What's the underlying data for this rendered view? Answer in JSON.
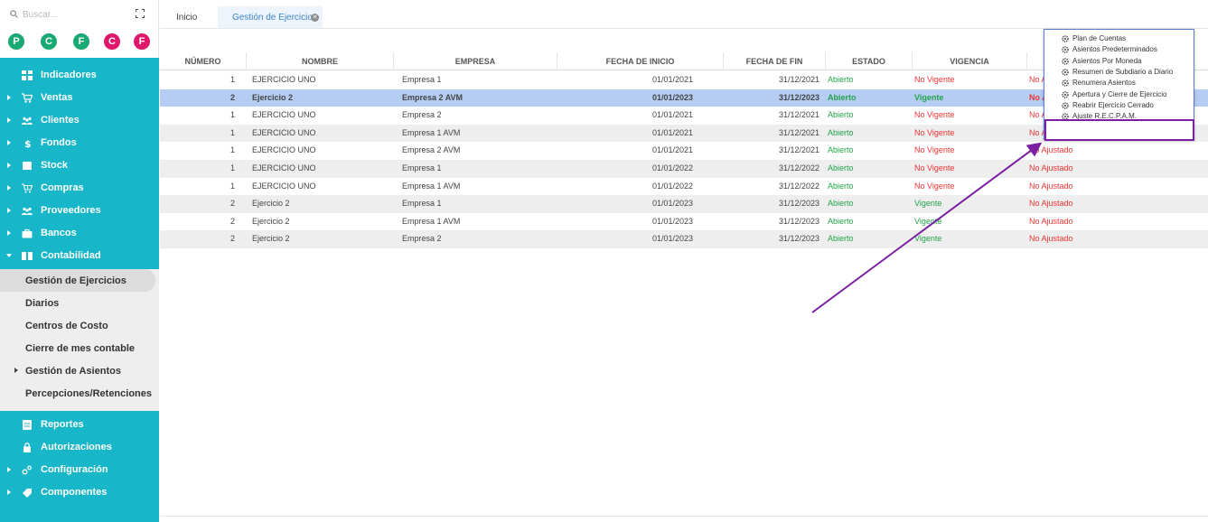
{
  "search": {
    "placeholder": "Buscar..."
  },
  "avatars": [
    {
      "letter": "P",
      "color": "#19a974"
    },
    {
      "letter": "C",
      "color": "#19a974"
    },
    {
      "letter": "F",
      "color": "#19a974"
    },
    {
      "letter": "C",
      "color": "#e0186c"
    },
    {
      "letter": "F",
      "color": "#e0186c"
    }
  ],
  "sidebar": {
    "items": [
      {
        "label": "Indicadores"
      },
      {
        "label": "Ventas"
      },
      {
        "label": "Clientes"
      },
      {
        "label": "Fondos"
      },
      {
        "label": "Stock"
      },
      {
        "label": "Compras"
      },
      {
        "label": "Proveedores"
      },
      {
        "label": "Bancos"
      },
      {
        "label": "Contabilidad"
      }
    ],
    "submenu": [
      {
        "label": "Gestión de Ejercicios"
      },
      {
        "label": "Diarios"
      },
      {
        "label": "Centros de Costo"
      },
      {
        "label": "Cierre de mes contable"
      },
      {
        "label": "Gestión de Asientos"
      },
      {
        "label": "Percepciones/Retenciones"
      }
    ],
    "bottom_items": [
      {
        "label": "Reportes"
      },
      {
        "label": "Autorizaciones"
      },
      {
        "label": "Configuración"
      },
      {
        "label": "Componentes"
      }
    ]
  },
  "tabs": {
    "home": "Inicio",
    "active": "Gestión de Ejercicios"
  },
  "table": {
    "columns": [
      "NÚMERO",
      "NOMBRE",
      "EMPRESA",
      "FECHA DE INICIO",
      "FECHA DE FIN",
      "ESTADO",
      "VIGENCIA"
    ],
    "rows": [
      {
        "numero": "1",
        "nombre": "EJERCICIO UNO",
        "empresa": "Empresa 1",
        "inicio": "01/01/2021",
        "fin": "31/12/2021",
        "estado": "Abierto",
        "vigencia": "No Vigente",
        "ajuste": "No A"
      },
      {
        "numero": "2",
        "nombre": "Ejercicio 2",
        "empresa": "Empresa 2 AVM",
        "inicio": "01/01/2023",
        "fin": "31/12/2023",
        "estado": "Abierto",
        "vigencia": "Vigente",
        "ajuste": "No A"
      },
      {
        "numero": "1",
        "nombre": "EJERCICIO UNO",
        "empresa": "Empresa 2",
        "inicio": "01/01/2021",
        "fin": "31/12/2021",
        "estado": "Abierto",
        "vigencia": "No Vigente",
        "ajuste": "No A"
      },
      {
        "numero": "1",
        "nombre": "EJERCICIO UNO",
        "empresa": "Empresa 1 AVM",
        "inicio": "01/01/2021",
        "fin": "31/12/2021",
        "estado": "Abierto",
        "vigencia": "No Vigente",
        "ajuste": "No A"
      },
      {
        "numero": "1",
        "nombre": "EJERCICIO UNO",
        "empresa": "Empresa 2 AVM",
        "inicio": "01/01/2021",
        "fin": "31/12/2021",
        "estado": "Abierto",
        "vigencia": "No Vigente",
        "ajuste": "No Ajustado"
      },
      {
        "numero": "1",
        "nombre": "EJERCICIO UNO",
        "empresa": "Empresa 1",
        "inicio": "01/01/2022",
        "fin": "31/12/2022",
        "estado": "Abierto",
        "vigencia": "No Vigente",
        "ajuste": "No Ajustado"
      },
      {
        "numero": "1",
        "nombre": "EJERCICIO UNO",
        "empresa": "Empresa 1 AVM",
        "inicio": "01/01/2022",
        "fin": "31/12/2022",
        "estado": "Abierto",
        "vigencia": "No Vigente",
        "ajuste": "No Ajustado"
      },
      {
        "numero": "2",
        "nombre": "Ejercicio 2",
        "empresa": "Empresa 1",
        "inicio": "01/01/2023",
        "fin": "31/12/2023",
        "estado": "Abierto",
        "vigencia": "Vigente",
        "ajuste": "No Ajustado"
      },
      {
        "numero": "2",
        "nombre": "Ejercicio 2",
        "empresa": "Empresa 1 AVM",
        "inicio": "01/01/2023",
        "fin": "31/12/2023",
        "estado": "Abierto",
        "vigencia": "Vigente",
        "ajuste": "No Ajustado"
      },
      {
        "numero": "2",
        "nombre": "Ejercicio 2",
        "empresa": "Empresa 2",
        "inicio": "01/01/2023",
        "fin": "31/12/2023",
        "estado": "Abierto",
        "vigencia": "Vigente",
        "ajuste": "No Ajustado"
      }
    ]
  },
  "popup": {
    "items": [
      "Plan de Cuentas",
      "Asientos Predeterminados",
      "Asientos Por Moneda",
      "Resumen de Subdiario a Diario",
      "Renumera Asientos",
      "Apertura y Cierre de Ejercicio",
      "Reabrir Ejercicio Cerrado",
      "Ajuste R.E.C.P.A.M."
    ]
  },
  "colors": {
    "sidebar": "#17b6c9",
    "selected_row": "#b5cdf2",
    "green": "#23a34a",
    "red": "#e33333",
    "annotation": "#7b1fa2",
    "tab_active_text": "#3b86c6"
  }
}
